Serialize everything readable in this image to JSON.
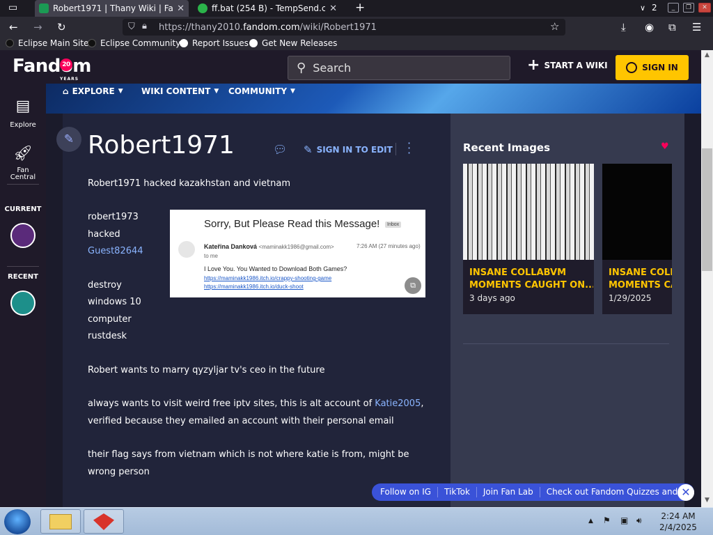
{
  "browser": {
    "tabs": [
      {
        "title": "Robert1971 | Thany Wiki | Fandc",
        "active": true
      },
      {
        "title": "ff.bat (254 B) - TempSend.com",
        "active": false
      }
    ],
    "new_tab": "+",
    "tab_count": "2",
    "url_prefix": "https://thany2010.",
    "url_host": "fandom.com",
    "url_path": "/wiki/Robert1971",
    "bookmarks": [
      "Eclipse Main Site",
      "Eclipse Community",
      "Report Issues",
      "Get New Releases"
    ]
  },
  "fandom": {
    "logo": "Fandom",
    "logo_badge": "20",
    "logo_years": "YEARS",
    "search_label": "Search",
    "start_wiki": "START A WIKI",
    "sign_in": "SIGN IN"
  },
  "rail": {
    "explore": "Explore",
    "fan_central_1": "Fan",
    "fan_central_2": "Central",
    "current": "CURRENT",
    "recent": "RECENT"
  },
  "wikinav": {
    "explore": "EXPLORE",
    "wiki_content": "WIKI CONTENT",
    "community": "COMMUNITY"
  },
  "page": {
    "title": "Robert1971",
    "sign_in_to_edit": "SIGN IN TO EDIT",
    "p1": "Robert1971 hacked kazakhstan and vietnam",
    "l1": "robert1973",
    "l2": "hacked",
    "l3_link": "Guest82644",
    "l4": "destroy",
    "l5": "windows 10",
    "l6": "computer",
    "l7": "rustdesk",
    "p2": "Robert wants to marry qyzyljar tv's ceo in the future",
    "p3a": "always wants to visit weird free iptv sites, this is alt account of ",
    "p3_link": "Katie2005",
    "p3b": ",",
    "p3c": "verified because they emailed an account with their personal email",
    "p4a": "their flag says from vietnam which is not where katie is from, might be",
    "p4b": "wrong person"
  },
  "email": {
    "subject": "Sorry, But Please Read this Message!",
    "inbox": "Inbox",
    "sender": "Kateřina Danková",
    "sender_addr": "<maminakk1986@gmail.com>",
    "time": "7:26 AM (27 minutes ago)",
    "to": "to me",
    "body": "I Love You. You Wanted to Download Both Games?",
    "link1": "https://maminakk1986.itch.io/crappy-shooting-game",
    "link2": "https://maminakk1986.itch.io/duck-shoot"
  },
  "recent_images": {
    "heading": "Recent Images",
    "cards": [
      {
        "title": "INSANE COLLABVM",
        "title2": "MOMENTS CAUGHT ON...",
        "date": "3 days ago"
      },
      {
        "title": "INSANE COLL",
        "title2": "MOMENTS CA",
        "date": "1/29/2025"
      }
    ]
  },
  "pillbar": {
    "items": [
      "Follow on IG",
      "TikTok",
      "Join Fan Lab",
      "Check out Fandom Quizzes and cha"
    ]
  },
  "taskbar": {
    "time": "2:24 AM",
    "date": "2/4/2025"
  },
  "colors": {
    "fandom_yellow": "#ffc500",
    "fandom_pink": "#fa005a",
    "link_blue": "#8ab4ff",
    "page_bg": "#21243a"
  }
}
